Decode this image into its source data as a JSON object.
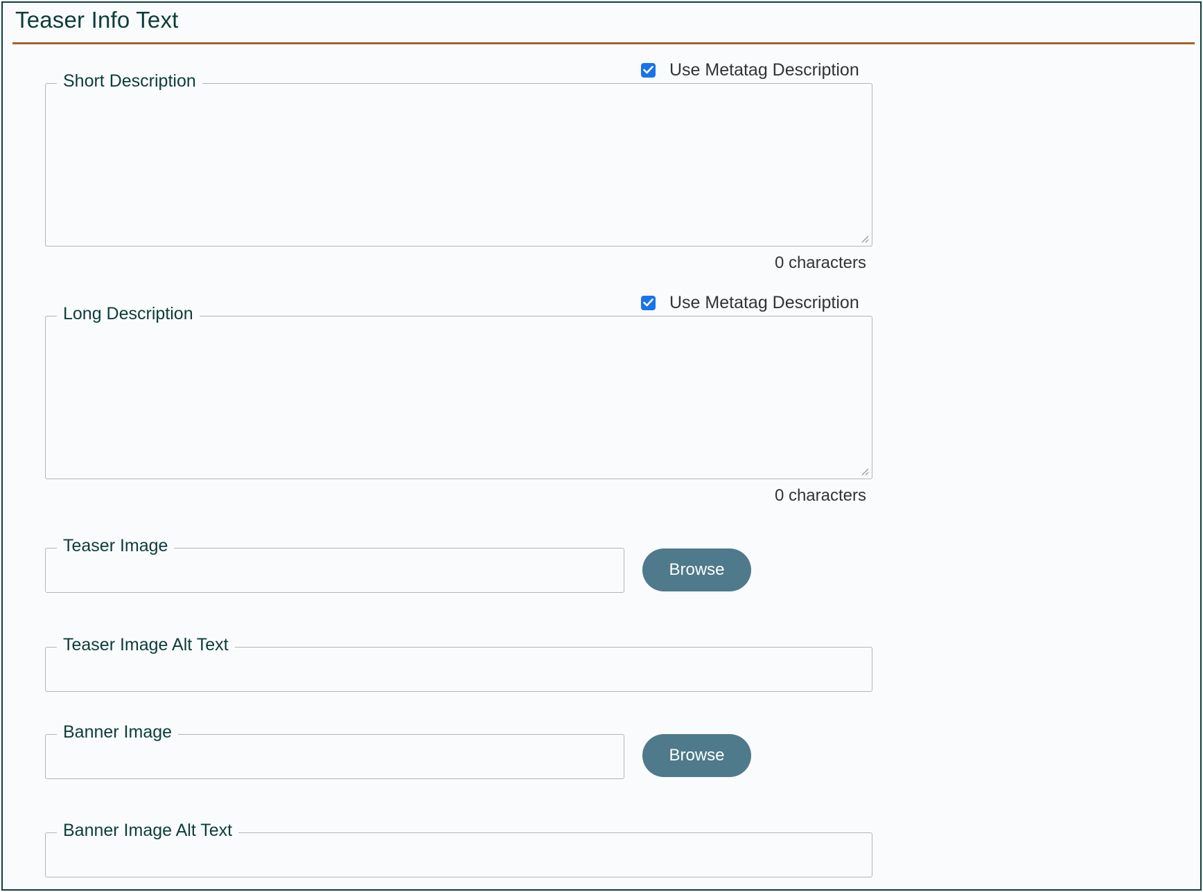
{
  "panel": {
    "title": "Teaser Info Text"
  },
  "short_description": {
    "legend": "Short Description",
    "metatag_label": "Use Metatag Description",
    "metatag_checked": true,
    "value": "",
    "char_count": "0 characters"
  },
  "long_description": {
    "legend": "Long Description",
    "metatag_label": "Use Metatag Description",
    "metatag_checked": true,
    "value": "",
    "char_count": "0 characters"
  },
  "teaser_image": {
    "legend": "Teaser Image",
    "value": "",
    "browse_label": "Browse"
  },
  "teaser_image_alt": {
    "legend": "Teaser Image Alt Text",
    "value": ""
  },
  "banner_image": {
    "legend": "Banner Image",
    "value": "",
    "browse_label": "Browse"
  },
  "banner_image_alt": {
    "legend": "Banner Image Alt Text",
    "value": ""
  },
  "colors": {
    "accent_rule": "#a5612c",
    "heading": "#0b3d3a",
    "button": "#4e7a8b",
    "checkbox": "#1a73e8"
  }
}
